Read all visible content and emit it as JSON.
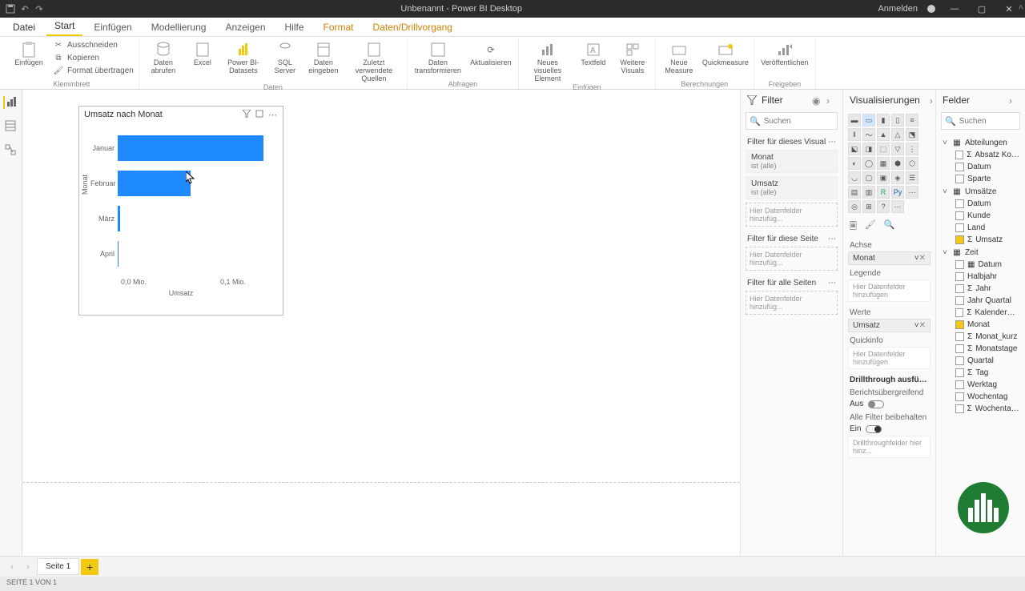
{
  "titlebar": {
    "title": "Unbenannt - Power BI Desktop",
    "signin": "Anmelden"
  },
  "menu": {
    "file": "Datei",
    "start": "Start",
    "insert": "Einfügen",
    "model": "Modellierung",
    "view": "Anzeigen",
    "help": "Hilfe",
    "format": "Format",
    "drill": "Daten/Drillvorgang"
  },
  "ribbon": {
    "paste": "Einfügen",
    "cut": "Ausschneiden",
    "copy": "Kopieren",
    "formatp": "Format übertragen",
    "g_clip": "Klemmbrett",
    "data": "Daten abrufen",
    "excel": "Excel",
    "pbids": "Power BI-Datasets",
    "sql": "SQL Server",
    "enter": "Daten eingeben",
    "recent": "Zuletzt verwendete Quellen",
    "g_data": "Daten",
    "transform": "Daten transformieren",
    "refresh": "Aktualisieren",
    "g_query": "Abfragen",
    "newvis": "Neues visuelles Element",
    "textbox": "Textfeld",
    "morevis": "Weitere Visuals",
    "g_insert": "Einfügen",
    "measure": "Neue Measure",
    "quick": "Quickmeasure",
    "g_calc": "Berechnungen",
    "publish": "Veröffentlichen",
    "g_share": "Freigeben"
  },
  "chart_data": {
    "type": "bar",
    "title": "Umsatz nach Monat",
    "ylabel": "Monat",
    "xlabel": "Umsatz",
    "categories": [
      "Januar",
      "Februar",
      "März",
      "April"
    ],
    "values": [
      0.13,
      0.065,
      0.002,
      0.001
    ],
    "xticks": [
      "0,0 Mio.",
      "0,1 Mio."
    ],
    "xlim": [
      0,
      0.14
    ]
  },
  "filter": {
    "title": "Filter",
    "search": "Suchen",
    "sec_visual": "Filter für dieses Visual",
    "f1": "Monat",
    "f1s": "ist (alle)",
    "f2": "Umsatz",
    "f2s": "ist (alle)",
    "drop1": "Hier Datenfelder hinzufüg...",
    "sec_page": "Filter für diese Seite",
    "drop2": "Hier Datenfelder hinzufüg...",
    "sec_all": "Filter für alle Seiten",
    "drop3": "Hier Datenfelder hinzufüg..."
  },
  "viz": {
    "title": "Visualisierungen",
    "axis": "Achse",
    "axis_val": "Monat",
    "legend": "Legende",
    "legend_drop": "Hier Datenfelder hinzufügen",
    "values": "Werte",
    "values_val": "Umsatz",
    "tooltip": "Quickinfo",
    "tooltip_drop": "Hier Datenfelder hinzufügen",
    "drill": "Drillthrough ausfü…",
    "cross": "Berichtsübergreifend",
    "off": "Aus",
    "keep": "Alle Filter beibehalten",
    "on": "Ein",
    "drilldrop": "Drillthroughfelder hier hinz..."
  },
  "fields": {
    "title": "Felder",
    "search": "Suchen",
    "t1": "Abteilungen",
    "t1_1": "Absatz Kom...",
    "t1_2": "Datum",
    "t1_3": "Sparte",
    "t2": "Umsätze",
    "t2_1": "Datum",
    "t2_2": "Kunde",
    "t2_3": "Land",
    "t2_4": "Umsatz",
    "t3": "Zeit",
    "t3_1": "Datum",
    "t3_2": "Halbjahr",
    "t3_3": "Jahr",
    "t3_4": "Jahr Quartal",
    "t3_5": "Kalenderwo...",
    "t3_6": "Monat",
    "t3_7": "Monat_kurz",
    "t3_8": "Monatstage",
    "t3_9": "Quartal",
    "t3_10": "Tag",
    "t3_11": "Werktag",
    "t3_12": "Wochentag",
    "t3_13": "Wochentag..."
  },
  "page": {
    "tab": "Seite 1"
  },
  "status": {
    "text": "SEITE 1 VON 1"
  }
}
